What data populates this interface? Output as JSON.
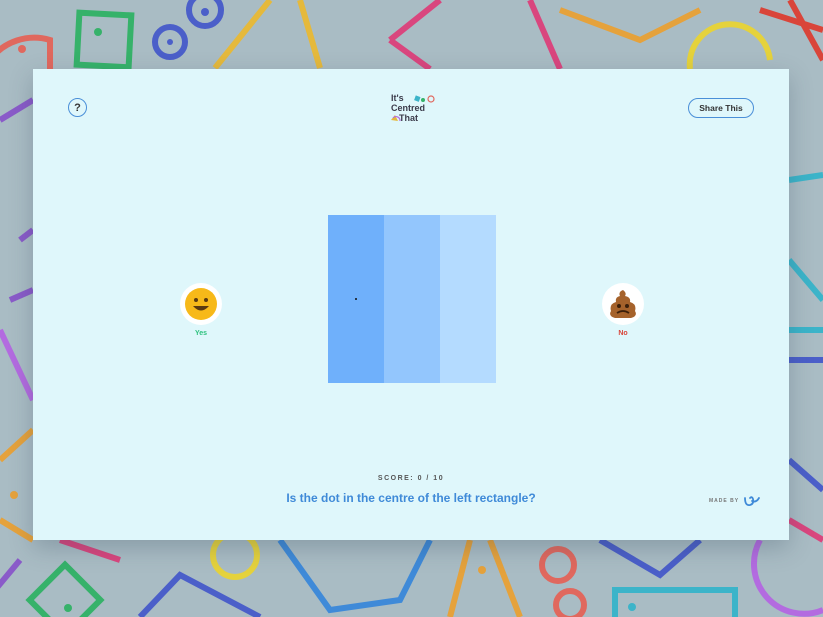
{
  "header": {
    "help_label": "?",
    "logo_lines": [
      "It's",
      "Centred",
      "That"
    ],
    "share_label": "Share This"
  },
  "answers": {
    "yes_label": "Yes",
    "no_label": "No",
    "yes_icon": "smiley-face-icon",
    "no_icon": "poop-icon"
  },
  "footer": {
    "score_text": "SCORE: 0 / 10",
    "question": "Is the dot in the centre of the left rectangle?",
    "made_by": "MADE BY"
  },
  "colors": {
    "background": "#a9bcc4",
    "card": "#dff7fb",
    "accent": "#4a8fd8",
    "rect_left": "#6fb0fb",
    "rect_middle": "#93c6fd",
    "rect_right": "#b4dbff",
    "yes": "#2ec27e",
    "no": "#d9453a"
  }
}
